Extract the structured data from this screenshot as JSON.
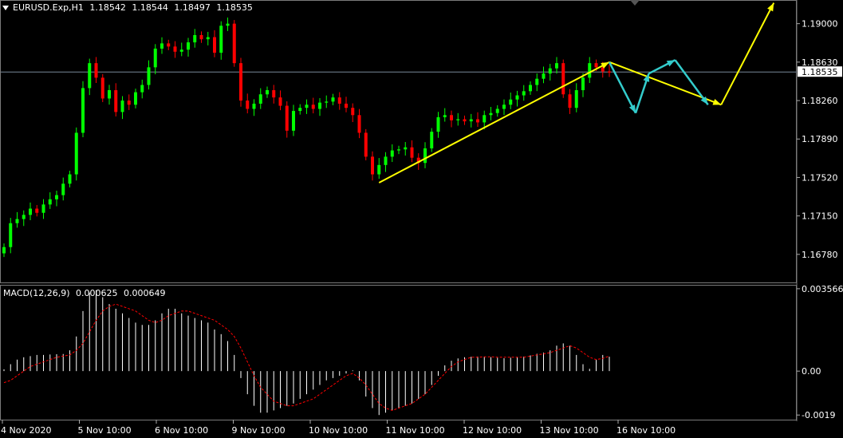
{
  "header": {
    "symbol": "EURUSD.Exp,H1",
    "open": "1.18542",
    "high": "1.18544",
    "low": "1.18497",
    "close": "1.18535"
  },
  "macd_header": {
    "name": "MACD(12,26,9)",
    "main": "0.000625",
    "signal": "0.000649"
  },
  "colors": {
    "background": "#000000",
    "bull": "#00ff00",
    "bear": "#ff0000",
    "grid": "#7a7a7a",
    "current_price_line": "#778899",
    "forecast_primary": "#ffff00",
    "forecast_secondary": "#33cccc",
    "macd_hist": "#ffffff",
    "macd_signal": "#ff0000"
  },
  "chart_data": [
    {
      "type": "candlestick",
      "title": "EURUSD.Exp,H1",
      "current_price": "1.18535",
      "y_ticks": [
        "1.19000",
        "1.18630",
        "1.18260",
        "1.17890",
        "1.17520",
        "1.17150",
        "1.16780"
      ],
      "ylim": [
        1.1651,
        1.1922
      ],
      "x_ticks": [
        "4 Nov 2020",
        "5 Nov 10:00",
        "6 Nov 10:00",
        "9 Nov 10:00",
        "10 Nov 10:00",
        "11 Nov 10:00",
        "12 Nov 10:00",
        "13 Nov 10:00",
        "16 Nov 10:00"
      ],
      "closes": [
        1.1685,
        1.1708,
        1.1712,
        1.1716,
        1.1722,
        1.1718,
        1.1726,
        1.1731,
        1.1735,
        1.1746,
        1.1755,
        1.1795,
        1.1838,
        1.1862,
        1.1848,
        1.1828,
        1.1836,
        1.1815,
        1.1826,
        1.1822,
        1.1834,
        1.1841,
        1.1858,
        1.1876,
        1.1881,
        1.1878,
        1.1873,
        1.1875,
        1.1882,
        1.1889,
        1.1885,
        1.1887,
        1.1872,
        1.1898,
        1.19,
        1.1862,
        1.1826,
        1.1818,
        1.1823,
        1.1832,
        1.1836,
        1.1829,
        1.1821,
        1.1797,
        1.1816,
        1.1819,
        1.1822,
        1.1818,
        1.1824,
        1.1825,
        1.1829,
        1.1823,
        1.1819,
        1.1812,
        1.1795,
        1.1772,
        1.1755,
        1.1764,
        1.1772,
        1.1778,
        1.1779,
        1.1781,
        1.1771,
        1.1766,
        1.178,
        1.1796,
        1.181,
        1.1812,
        1.1807,
        1.1808,
        1.1806,
        1.1808,
        1.1805,
        1.1812,
        1.1814,
        1.1818,
        1.1822,
        1.1827,
        1.1831,
        1.1835,
        1.1841,
        1.1847,
        1.1852,
        1.1857,
        1.1862,
        1.1832,
        1.1819,
        1.1836,
        1.1848,
        1.1862,
        1.1858,
        1.1854,
        1.1853
      ],
      "forecast_yellow": [
        {
          "time_index": 57,
          "price": 1.1747
        },
        {
          "time_index": 92,
          "price": 1.1863
        },
        {
          "time_index": 109,
          "price": 1.1822
        },
        {
          "time_index": 117,
          "price": 1.192
        }
      ],
      "forecast_cyan": [
        {
          "time_index": 92,
          "price": 1.1863
        },
        {
          "time_index": 96,
          "price": 1.1814
        },
        {
          "time_index": 98,
          "price": 1.1852
        },
        {
          "time_index": 102,
          "price": 1.1865
        },
        {
          "time_index": 107,
          "price": 1.1822
        }
      ]
    },
    {
      "type": "bar",
      "title": "MACD(12,26,9)",
      "y_ticks": [
        "0.003566",
        "0.00",
        "-0.0019"
      ],
      "ylim": [
        -0.0021,
        0.0037
      ],
      "series": [
        {
          "name": "MACD",
          "values": [
            8e-05,
            0.0003,
            0.0005,
            0.0006,
            0.00065,
            0.0007,
            0.0007,
            0.00072,
            0.00073,
            0.00074,
            0.0009,
            0.0015,
            0.0026,
            0.0034,
            0.0035,
            0.0032,
            0.0029,
            0.0027,
            0.0025,
            0.0023,
            0.0021,
            0.002,
            0.002,
            0.0022,
            0.0025,
            0.0027,
            0.0027,
            0.0025,
            0.0024,
            0.0023,
            0.0022,
            0.0021,
            0.0018,
            0.0016,
            0.0013,
            0.0007,
            -0.0003,
            -0.001,
            -0.0015,
            -0.0018,
            -0.0018,
            -0.0017,
            -0.0016,
            -0.0015,
            -0.0014,
            -0.0012,
            -0.001,
            -0.0008,
            -0.0006,
            -0.0004,
            -0.0003,
            -0.0002,
            -0.0001,
            3e-05,
            -0.0004,
            -0.0011,
            -0.0016,
            -0.0019,
            -0.0018,
            -0.0017,
            -0.0016,
            -0.0015,
            -0.0014,
            -0.0012,
            -0.001,
            -0.0006,
            -0.0002,
            0.00025,
            0.00045,
            0.00055,
            0.0006,
            0.00062,
            0.00063,
            0.00063,
            0.0006,
            0.00058,
            0.00056,
            0.00058,
            0.0006,
            0.00063,
            0.00068,
            0.00075,
            0.0008,
            0.0009,
            0.0011,
            0.0012,
            0.0011,
            0.0007,
            0.0003,
            0.0001,
            0.0005,
            0.0007,
            0.000625
          ]
        },
        {
          "name": "Signal",
          "values": [
            -0.0005,
            -0.0004,
            -0.0002,
            0.0,
            0.0002,
            0.0003,
            0.0004,
            0.0005,
            0.0006,
            0.00065,
            0.0007,
            0.0009,
            0.0012,
            0.0017,
            0.0022,
            0.0026,
            0.0028,
            0.0029,
            0.0028,
            0.0027,
            0.0026,
            0.0024,
            0.0022,
            0.0021,
            0.0022,
            0.0024,
            0.0025,
            0.0026,
            0.0026,
            0.0025,
            0.0024,
            0.0023,
            0.0022,
            0.002,
            0.0018,
            0.0015,
            0.001,
            0.0004,
            -0.0002,
            -0.0007,
            -0.001,
            -0.0013,
            -0.0014,
            -0.0015,
            -0.0015,
            -0.0014,
            -0.0013,
            -0.0012,
            -0.001,
            -0.0008,
            -0.0006,
            -0.0004,
            -0.0002,
            -0.0001,
            -0.0003,
            -0.0006,
            -0.001,
            -0.0014,
            -0.0016,
            -0.0017,
            -0.0016,
            -0.0015,
            -0.0014,
            -0.0012,
            -0.001,
            -0.0007,
            -0.0004,
            -0.0001,
            0.0002,
            0.0004,
            0.0005,
            0.0006,
            0.0006,
            0.00062,
            0.00062,
            0.0006,
            0.0006,
            0.0006,
            0.0006,
            0.0006,
            0.00065,
            0.0007,
            0.00075,
            0.0008,
            0.0009,
            0.001,
            0.0011,
            0.001,
            0.0008,
            0.0006,
            0.0005,
            0.00055,
            0.000649
          ]
        }
      ]
    }
  ]
}
